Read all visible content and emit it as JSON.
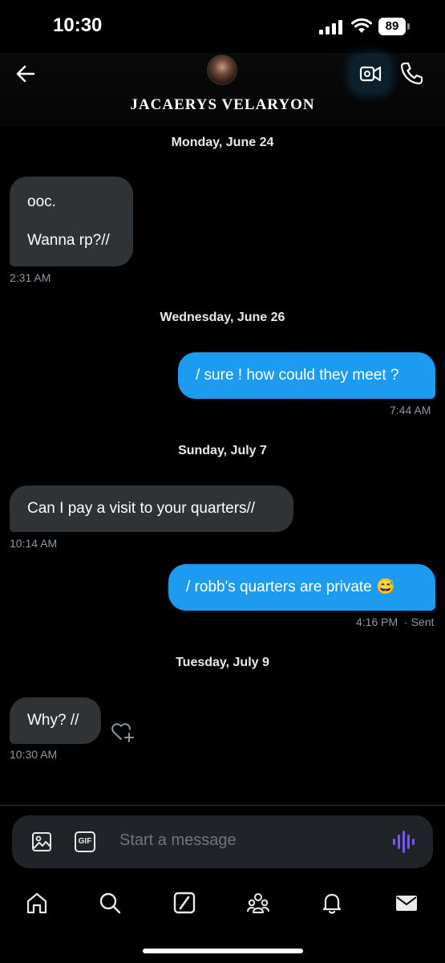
{
  "status_bar": {
    "time": "10:30",
    "battery": "89"
  },
  "header": {
    "contact_name": "JACAERYS VELARYON"
  },
  "messages": [
    {
      "day": "Monday, June 24"
    },
    {
      "direction": "incoming",
      "lines": [
        "ooc.",
        "Wanna rp?//"
      ],
      "time": "2:31 AM"
    },
    {
      "day": "Wednesday, June 26"
    },
    {
      "direction": "outgoing",
      "text": "/ sure ! how could they meet ?",
      "time": "7:44 AM"
    },
    {
      "day": "Sunday, July 7"
    },
    {
      "direction": "incoming",
      "text": "Can I pay a visit to your quarters//",
      "time": "10:14 AM"
    },
    {
      "direction": "outgoing",
      "text": "/ robb's quarters are private 😅",
      "time": "4:16 PM",
      "status": "· Sent"
    },
    {
      "day": "Tuesday, July 9"
    },
    {
      "direction": "incoming",
      "text": "Why? //",
      "time": "10:30 AM"
    }
  ],
  "composer": {
    "placeholder": "Start a message",
    "gif_label": "GIF"
  },
  "nav": [
    "home-icon",
    "search-icon",
    "grok-icon",
    "communities-icon",
    "notifications-icon",
    "messages-icon"
  ],
  "colors": {
    "accent": "#1d9bf0",
    "incoming_bubble": "#2f3336",
    "background": "#000000",
    "voice": "#7856ff"
  }
}
